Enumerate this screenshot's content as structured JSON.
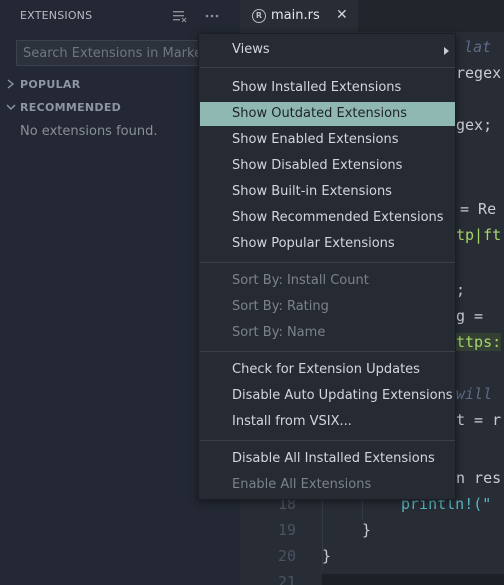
{
  "sidebar": {
    "title": "EXTENSIONS",
    "search_placeholder": "Search Extensions in Marketplace",
    "sections": [
      {
        "label": "POPULAR",
        "expanded": false
      },
      {
        "label": "RECOMMENDED",
        "expanded": true
      }
    ],
    "empty_message": "No extensions found."
  },
  "editor": {
    "tab": {
      "icon": "rust-file-icon",
      "label": "main.rs"
    },
    "code_fragments": [
      {
        "text": "e lat",
        "cls": "c-comment"
      },
      {
        "text": "regex",
        "cls": "c-text"
      },
      {
        "text": "gex;",
        "cls": "c-text"
      },
      {
        "text": "= Re",
        "cls": "c-text"
      },
      {
        "text": "tp|ft",
        "cls": "c-green"
      },
      {
        "text": ";",
        "cls": "c-text"
      },
      {
        "text": "g =",
        "cls": "c-text"
      },
      {
        "text": "ttps:",
        "cls": "c-green-hl"
      },
      {
        "text": " will",
        "cls": "c-comment"
      },
      {
        "text": "t = r",
        "cls": "c-text"
      },
      {
        "text": "n res",
        "cls": "c-text"
      },
      {
        "text": "println!(\"",
        "cls": "c-cyan"
      },
      {
        "text": "}",
        "cls": "c-text"
      },
      {
        "text": "}",
        "cls": "c-text"
      }
    ],
    "line_numbers": [
      "18",
      "19",
      "20",
      "21"
    ]
  },
  "menu": {
    "items": [
      {
        "label": "Views",
        "submenu": true,
        "disabled": false,
        "active": false
      },
      {
        "label": "Show Installed Extensions",
        "disabled": false,
        "active": false
      },
      {
        "label": "Show Outdated Extensions",
        "disabled": false,
        "active": true
      },
      {
        "label": "Show Enabled Extensions",
        "disabled": false,
        "active": false
      },
      {
        "label": "Show Disabled Extensions",
        "disabled": false,
        "active": false
      },
      {
        "label": "Show Built-in Extensions",
        "disabled": false,
        "active": false
      },
      {
        "label": "Show Recommended Extensions",
        "disabled": false,
        "active": false
      },
      {
        "label": "Show Popular Extensions",
        "disabled": false,
        "active": false
      },
      {
        "label": "Sort By: Install Count",
        "disabled": true,
        "active": false
      },
      {
        "label": "Sort By: Rating",
        "disabled": true,
        "active": false
      },
      {
        "label": "Sort By: Name",
        "disabled": true,
        "active": false
      },
      {
        "label": "Check for Extension Updates",
        "disabled": false,
        "active": false
      },
      {
        "label": "Disable Auto Updating Extensions",
        "disabled": false,
        "active": false
      },
      {
        "label": "Install from VSIX...",
        "disabled": false,
        "active": false
      },
      {
        "label": "Disable All Installed Extensions",
        "disabled": false,
        "active": false
      },
      {
        "label": "Enable All Extensions",
        "disabled": true,
        "active": false
      }
    ]
  },
  "colors": {
    "menu_highlight": "#8fb8b3",
    "sidebar_bg": "#232834",
    "editor_bg": "#282c34"
  }
}
